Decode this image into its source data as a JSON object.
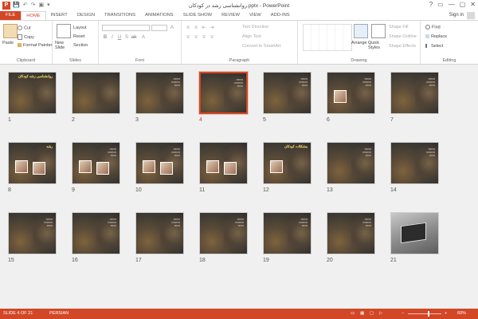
{
  "titlebar": {
    "app_icon": "P",
    "quick_access": [
      "💾",
      "↶",
      "↷",
      "▣",
      "▾"
    ],
    "title": "روانشناسی رشد در کودکان.pptx - PowerPoint",
    "controls": [
      "?",
      "▭",
      "—",
      "▢",
      "✕"
    ]
  },
  "tabs": [
    "FILE",
    "HOME",
    "INSERT",
    "DESIGN",
    "TRANSITIONS",
    "ANIMATIONS",
    "SLIDE SHOW",
    "REVIEW",
    "VIEW",
    "ADD-INS"
  ],
  "active_tab": "HOME",
  "signin": "Sign in",
  "ribbon": {
    "clipboard": {
      "label": "Clipboard",
      "paste": "Paste",
      "cut": "Cut",
      "copy": "Copy",
      "format_painter": "Format Painter"
    },
    "slides": {
      "label": "Slides",
      "new_slide": "New Slide",
      "layout": "Layout",
      "reset": "Reset",
      "section": "Section"
    },
    "font": {
      "label": "Font"
    },
    "paragraph": {
      "label": "Paragraph",
      "text_direction": "Text Direction",
      "align_text": "Align Text",
      "smartart": "Convert to SmartArt"
    },
    "drawing": {
      "label": "Drawing",
      "arrange": "Arrange",
      "quick_styles": "Quick Styles",
      "shape_fill": "Shape Fill",
      "shape_outline": "Shape Outline",
      "shape_effects": "Shape Effects"
    },
    "editing": {
      "label": "Editing",
      "find": "Find",
      "replace": "Replace",
      "select": "Select"
    }
  },
  "slides": [
    {
      "n": "1",
      "title": "روانشناسی رشد کودکان",
      "selected": false
    },
    {
      "n": "2",
      "title": "",
      "selected": false
    },
    {
      "n": "3",
      "title": "",
      "selected": false
    },
    {
      "n": "4",
      "title": "",
      "selected": true
    },
    {
      "n": "5",
      "title": "",
      "selected": false
    },
    {
      "n": "6",
      "title": "",
      "selected": false
    },
    {
      "n": "7",
      "title": "",
      "selected": false
    },
    {
      "n": "8",
      "title": "رشد",
      "selected": false
    },
    {
      "n": "9",
      "title": "",
      "selected": false
    },
    {
      "n": "10",
      "title": "",
      "selected": false
    },
    {
      "n": "11",
      "title": "",
      "selected": false
    },
    {
      "n": "12",
      "title": "مشکلات کودکان",
      "selected": false
    },
    {
      "n": "13",
      "title": "",
      "selected": false
    },
    {
      "n": "14",
      "title": "",
      "selected": false
    },
    {
      "n": "15",
      "title": "",
      "selected": false
    },
    {
      "n": "16",
      "title": "",
      "selected": false
    },
    {
      "n": "17",
      "title": "",
      "selected": false
    },
    {
      "n": "18",
      "title": "",
      "selected": false
    },
    {
      "n": "19",
      "title": "",
      "selected": false
    },
    {
      "n": "20",
      "title": "",
      "selected": false
    },
    {
      "n": "21",
      "title": "",
      "selected": false
    }
  ],
  "status": {
    "slide_info": "SLIDE 4 OF 21",
    "language": "PERSIAN",
    "zoom": "60%",
    "zoom_fraction": 0.6
  },
  "colors": {
    "accent": "#d24726",
    "workarea": "#f0f0f0"
  }
}
